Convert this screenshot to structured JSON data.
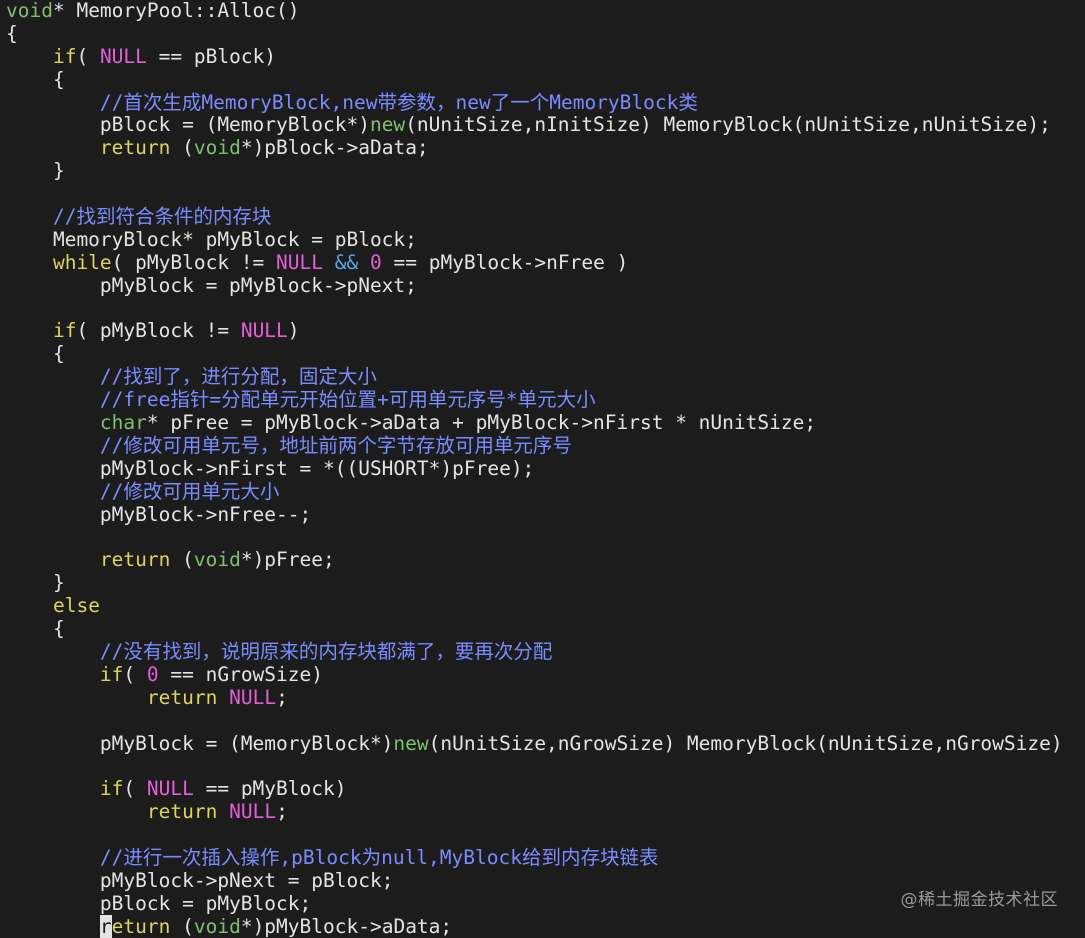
{
  "editor": {
    "lines": [
      [
        {
          "t": "void",
          "c": "type"
        },
        {
          "t": "* MemoryPool::Alloc()"
        }
      ],
      [
        {
          "t": "{"
        }
      ],
      [
        {
          "t": "    "
        },
        {
          "t": "if",
          "c": "kw"
        },
        {
          "t": "( "
        },
        {
          "t": "NULL",
          "c": "const"
        },
        {
          "t": " == pBlock)"
        }
      ],
      [
        {
          "t": "    {"
        }
      ],
      [
        {
          "t": "        "
        },
        {
          "t": "//首次生成MemoryBlock,new带参数，new了一个MemoryBlock类",
          "c": "cmt"
        }
      ],
      [
        {
          "t": "        pBlock = (MemoryBlock*)"
        },
        {
          "t": "new",
          "c": "new"
        },
        {
          "t": "(nUnitSize,nInitSize) MemoryBlock(nUnitSize,nUnitSize);"
        }
      ],
      [
        {
          "t": "        "
        },
        {
          "t": "return",
          "c": "kw"
        },
        {
          "t": " ("
        },
        {
          "t": "void",
          "c": "type"
        },
        {
          "t": "*)pBlock->aData;"
        }
      ],
      [
        {
          "t": "    }"
        }
      ],
      [
        {
          "t": ""
        }
      ],
      [
        {
          "t": "    "
        },
        {
          "t": "//找到符合条件的内存块",
          "c": "cmt"
        }
      ],
      [
        {
          "t": "    MemoryBlock* pMyBlock = pBlock;"
        }
      ],
      [
        {
          "t": "    "
        },
        {
          "t": "while",
          "c": "kw"
        },
        {
          "t": "( pMyBlock != "
        },
        {
          "t": "NULL",
          "c": "const"
        },
        {
          "t": " "
        },
        {
          "t": "&&",
          "c": "op"
        },
        {
          "t": " "
        },
        {
          "t": "0",
          "c": "const"
        },
        {
          "t": " == pMyBlock->nFree )"
        }
      ],
      [
        {
          "t": "        pMyBlock = pMyBlock->pNext;"
        }
      ],
      [
        {
          "t": ""
        }
      ],
      [
        {
          "t": "    "
        },
        {
          "t": "if",
          "c": "kw"
        },
        {
          "t": "( pMyBlock != "
        },
        {
          "t": "NULL",
          "c": "const"
        },
        {
          "t": ")"
        }
      ],
      [
        {
          "t": "    {"
        }
      ],
      [
        {
          "t": "        "
        },
        {
          "t": "//找到了，进行分配，固定大小",
          "c": "cmt"
        }
      ],
      [
        {
          "t": "        "
        },
        {
          "t": "//free指针=分配单元开始位置+可用单元序号*单元大小",
          "c": "cmt"
        }
      ],
      [
        {
          "t": "        "
        },
        {
          "t": "char",
          "c": "type"
        },
        {
          "t": "* pFree = pMyBlock->aData + pMyBlock->nFirst * nUnitSize;"
        }
      ],
      [
        {
          "t": "        "
        },
        {
          "t": "//修改可用单元号，地址前两个字节存放可用单元序号",
          "c": "cmt"
        }
      ],
      [
        {
          "t": "        pMyBlock->nFirst = *((USHORT*)pFree);"
        }
      ],
      [
        {
          "t": "        "
        },
        {
          "t": "//修改可用单元大小",
          "c": "cmt"
        }
      ],
      [
        {
          "t": "        pMyBlock->nFree--;"
        }
      ],
      [
        {
          "t": ""
        }
      ],
      [
        {
          "t": "        "
        },
        {
          "t": "return",
          "c": "kw"
        },
        {
          "t": " ("
        },
        {
          "t": "void",
          "c": "type"
        },
        {
          "t": "*)pFree;"
        }
      ],
      [
        {
          "t": "    }"
        }
      ],
      [
        {
          "t": "    "
        },
        {
          "t": "else",
          "c": "kw"
        }
      ],
      [
        {
          "t": "    {"
        }
      ],
      [
        {
          "t": "        "
        },
        {
          "t": "//没有找到，说明原来的内存块都满了，要再次分配",
          "c": "cmt"
        }
      ],
      [
        {
          "t": "        "
        },
        {
          "t": "if",
          "c": "kw"
        },
        {
          "t": "( "
        },
        {
          "t": "0",
          "c": "const"
        },
        {
          "t": " == nGrowSize)"
        }
      ],
      [
        {
          "t": "            "
        },
        {
          "t": "return",
          "c": "kw"
        },
        {
          "t": " "
        },
        {
          "t": "NULL",
          "c": "const"
        },
        {
          "t": ";"
        }
      ],
      [
        {
          "t": ""
        }
      ],
      [
        {
          "t": "        pMyBlock = (MemoryBlock*)"
        },
        {
          "t": "new",
          "c": "new"
        },
        {
          "t": "(nUnitSize,nGrowSize) MemoryBlock(nUnitSize,nGrowSize)"
        }
      ],
      [
        {
          "t": ""
        }
      ],
      [
        {
          "t": "        "
        },
        {
          "t": "if",
          "c": "kw"
        },
        {
          "t": "( "
        },
        {
          "t": "NULL",
          "c": "const"
        },
        {
          "t": " == pMyBlock)"
        }
      ],
      [
        {
          "t": "            "
        },
        {
          "t": "return",
          "c": "kw"
        },
        {
          "t": " "
        },
        {
          "t": "NULL",
          "c": "const"
        },
        {
          "t": ";"
        }
      ],
      [
        {
          "t": ""
        }
      ],
      [
        {
          "t": "        "
        },
        {
          "t": "//进行一次插入操作,pBlock为null,MyBlock给到内存块链表",
          "c": "cmt"
        }
      ],
      [
        {
          "t": "        pMyBlock->pNext = pBlock;"
        }
      ],
      [
        {
          "t": "        pBlock = pMyBlock;"
        }
      ],
      [
        {
          "t": "        "
        },
        {
          "t": "r",
          "c": "cursor"
        },
        {
          "t": "eturn",
          "c": "kw"
        },
        {
          "t": " ("
        },
        {
          "t": "void",
          "c": "type"
        },
        {
          "t": "*)pMyBlock->aData;"
        }
      ]
    ]
  },
  "watermark": {
    "text": "@稀土掘金技术社区"
  }
}
